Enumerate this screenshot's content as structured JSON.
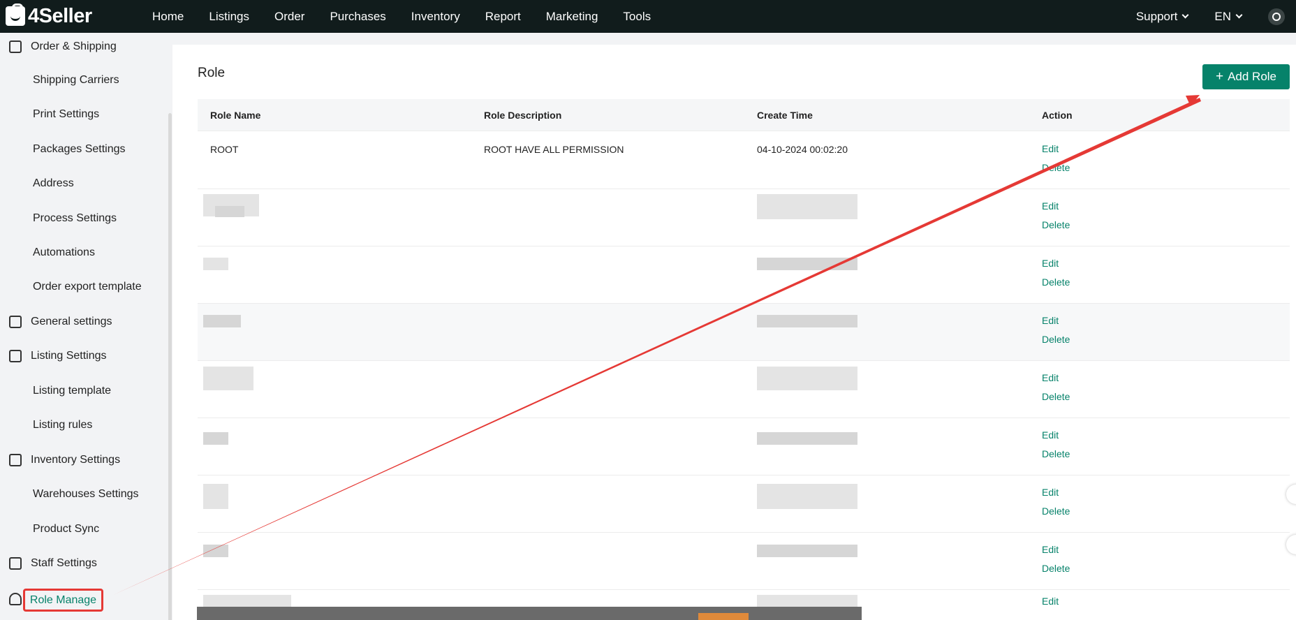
{
  "brand": {
    "name": "4Seller"
  },
  "nav": {
    "items": [
      "Home",
      "Listings",
      "Order",
      "Purchases",
      "Inventory",
      "Report",
      "Marketing",
      "Tools"
    ],
    "support_label": "Support",
    "language_label": "EN"
  },
  "sidebar": {
    "order_shipping": "Order & Shipping",
    "shipping_carriers": "Shipping Carriers",
    "print_settings": "Print Settings",
    "packages_settings": "Packages Settings",
    "address": "Address",
    "process_settings": "Process Settings",
    "automations": "Automations",
    "order_export_template": "Order export template",
    "general_settings": "General settings",
    "listing_settings": "Listing Settings",
    "listing_template": "Listing template",
    "listing_rules": "Listing rules",
    "inventory_settings": "Inventory Settings",
    "warehouses_settings": "Warehouses Settings",
    "product_sync": "Product Sync",
    "staff_settings": "Staff Settings",
    "role_manage": "Role Manage"
  },
  "page": {
    "title": "Role",
    "add_button": "Add Role"
  },
  "table": {
    "headers": [
      "Role Name",
      "Role Description",
      "Create Time",
      "Action"
    ],
    "rows": [
      {
        "name": "ROOT",
        "description": "ROOT HAVE ALL PERMISSION",
        "create_time": "04-10-2024 00:02:20"
      }
    ],
    "edit_label": "Edit",
    "delete_label": "Delete"
  },
  "colors": {
    "accent": "#06826a",
    "topbar": "#111c1c",
    "annotation": "#e53935"
  }
}
